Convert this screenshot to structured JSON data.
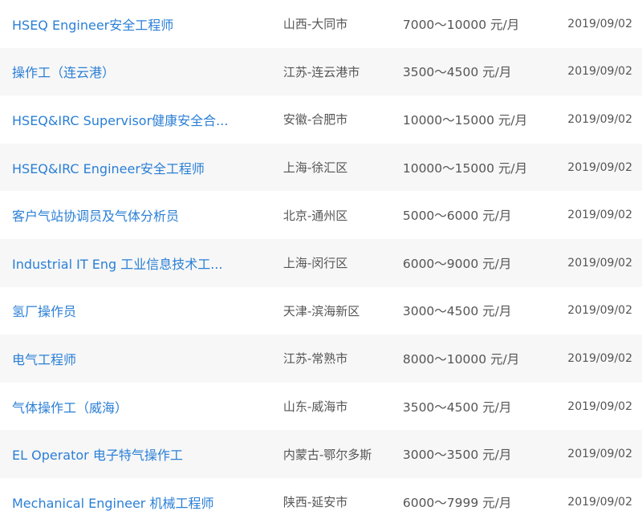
{
  "jobs": [
    {
      "title": "HSEQ Engineer安全工程师",
      "location": "山西-大同市",
      "salary": "7000～10000 元/月",
      "date": "2019/09/02"
    },
    {
      "title": "操作工（连云港）",
      "location": "江苏-连云港市",
      "salary": "3500～4500 元/月",
      "date": "2019/09/02"
    },
    {
      "title": "HSEQ&IRC Supervisor健康安全合...",
      "location": "安徽-合肥市",
      "salary": "10000～15000 元/月",
      "date": "2019/09/02"
    },
    {
      "title": "HSEQ&IRC Engineer安全工程师",
      "location": "上海-徐汇区",
      "salary": "10000～15000 元/月",
      "date": "2019/09/02"
    },
    {
      "title": "客户气站协调员及气体分析员",
      "location": "北京-通州区",
      "salary": "5000～6000 元/月",
      "date": "2019/09/02"
    },
    {
      "title": "Industrial IT Eng 工业信息技术工...",
      "location": "上海-闵行区",
      "salary": "6000～9000 元/月",
      "date": "2019/09/02"
    },
    {
      "title": "氢厂操作员",
      "location": "天津-滨海新区",
      "salary": "3000～4500 元/月",
      "date": "2019/09/02"
    },
    {
      "title": "电气工程师",
      "location": "江苏-常熟市",
      "salary": "8000～10000 元/月",
      "date": "2019/09/02"
    },
    {
      "title": "气体操作工（威海）",
      "location": "山东-威海市",
      "salary": "3500～4500 元/月",
      "date": "2019/09/02"
    },
    {
      "title": "EL Operator 电子特气操作工",
      "location": "内蒙古-鄂尔多斯",
      "salary": "3000～3500 元/月",
      "date": "2019/09/02"
    },
    {
      "title": "Mechanical Engineer 机械工程师",
      "location": "陕西-延安市",
      "salary": "6000～7999 元/月",
      "date": "2019/09/02"
    }
  ],
  "colors": {
    "link": "#2a7fd6",
    "text": "#555555",
    "stripe": "#f7f7f7"
  }
}
